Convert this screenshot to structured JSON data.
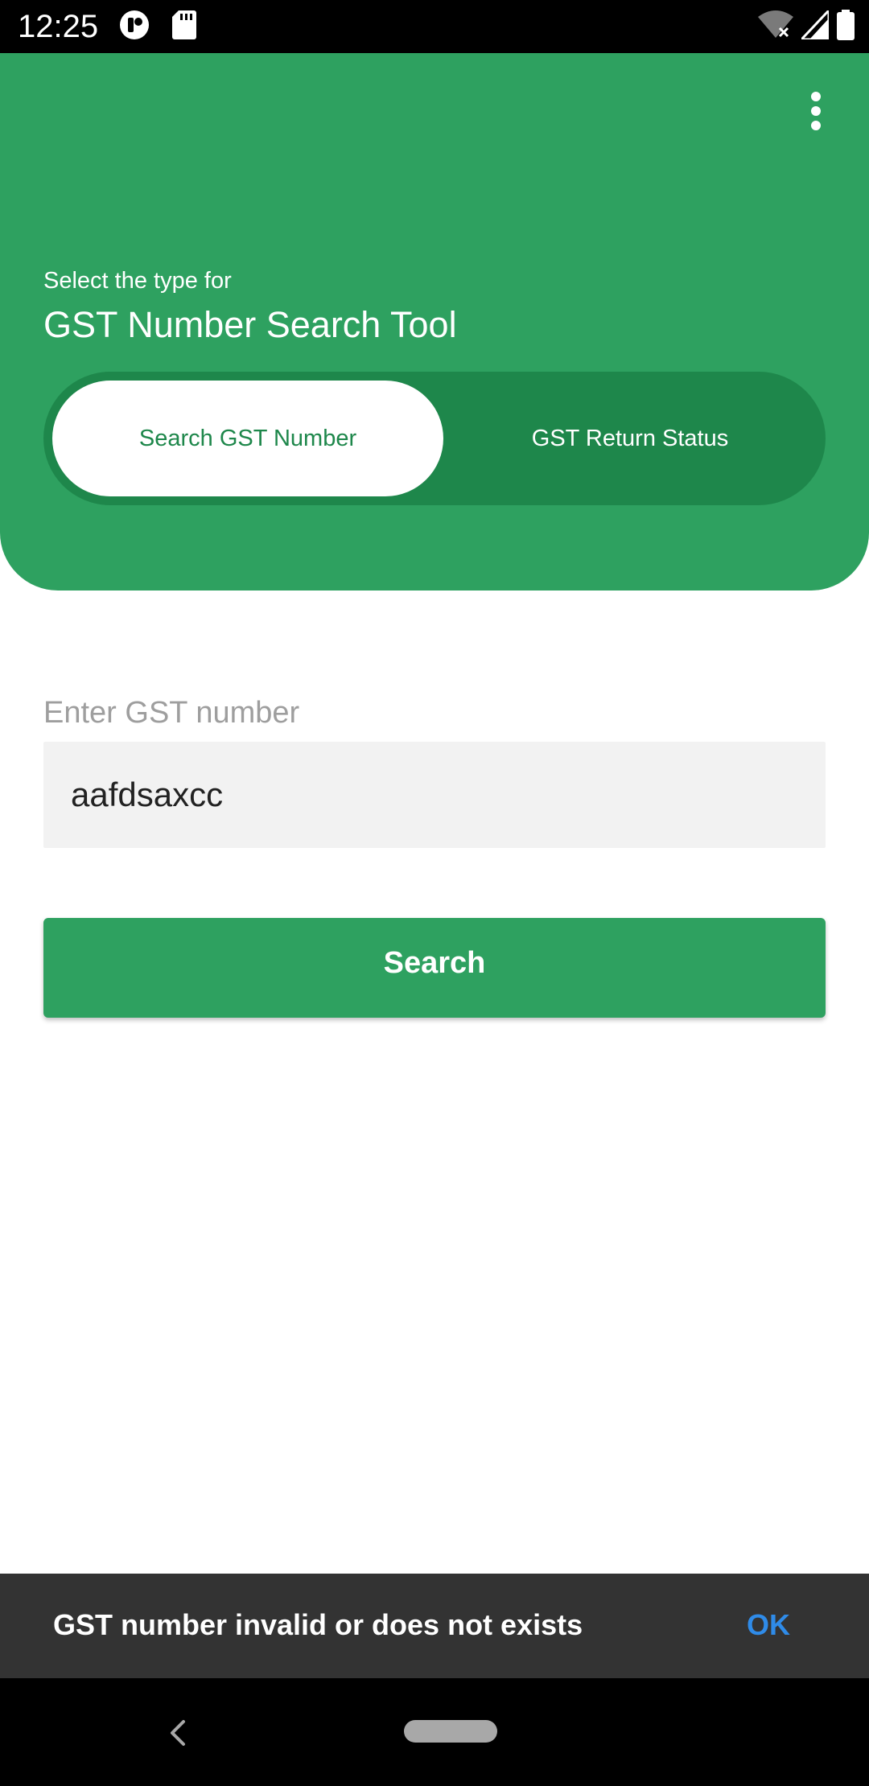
{
  "status_bar": {
    "time": "12:25",
    "icons_left": [
      "app-notification-icon",
      "sd-card-icon"
    ],
    "icons_right": [
      "wifi-off-icon",
      "signal-icon",
      "battery-icon"
    ]
  },
  "header": {
    "subtitle": "Select the type for",
    "title": "GST Number Search Tool",
    "menu_icon": "more-vert-icon",
    "tabs": [
      {
        "label": "Search GST Number",
        "selected": true
      },
      {
        "label": "GST Return Status",
        "selected": false
      }
    ]
  },
  "form": {
    "label": "Enter GST number",
    "input_value": "aafdsaxcc",
    "button_label": "Search"
  },
  "snackbar": {
    "message": "GST number invalid or does not exists",
    "action": "OK"
  },
  "nav_bar": {
    "back_icon": "back-chevron-icon",
    "home_icon": "home-pill-icon"
  },
  "colors": {
    "primary": "#2ea160",
    "primary_dark": "#1e874b",
    "snackbar_bg": "#333333",
    "snackbar_action": "#2f8be8",
    "input_bg": "#f2f2f2"
  }
}
